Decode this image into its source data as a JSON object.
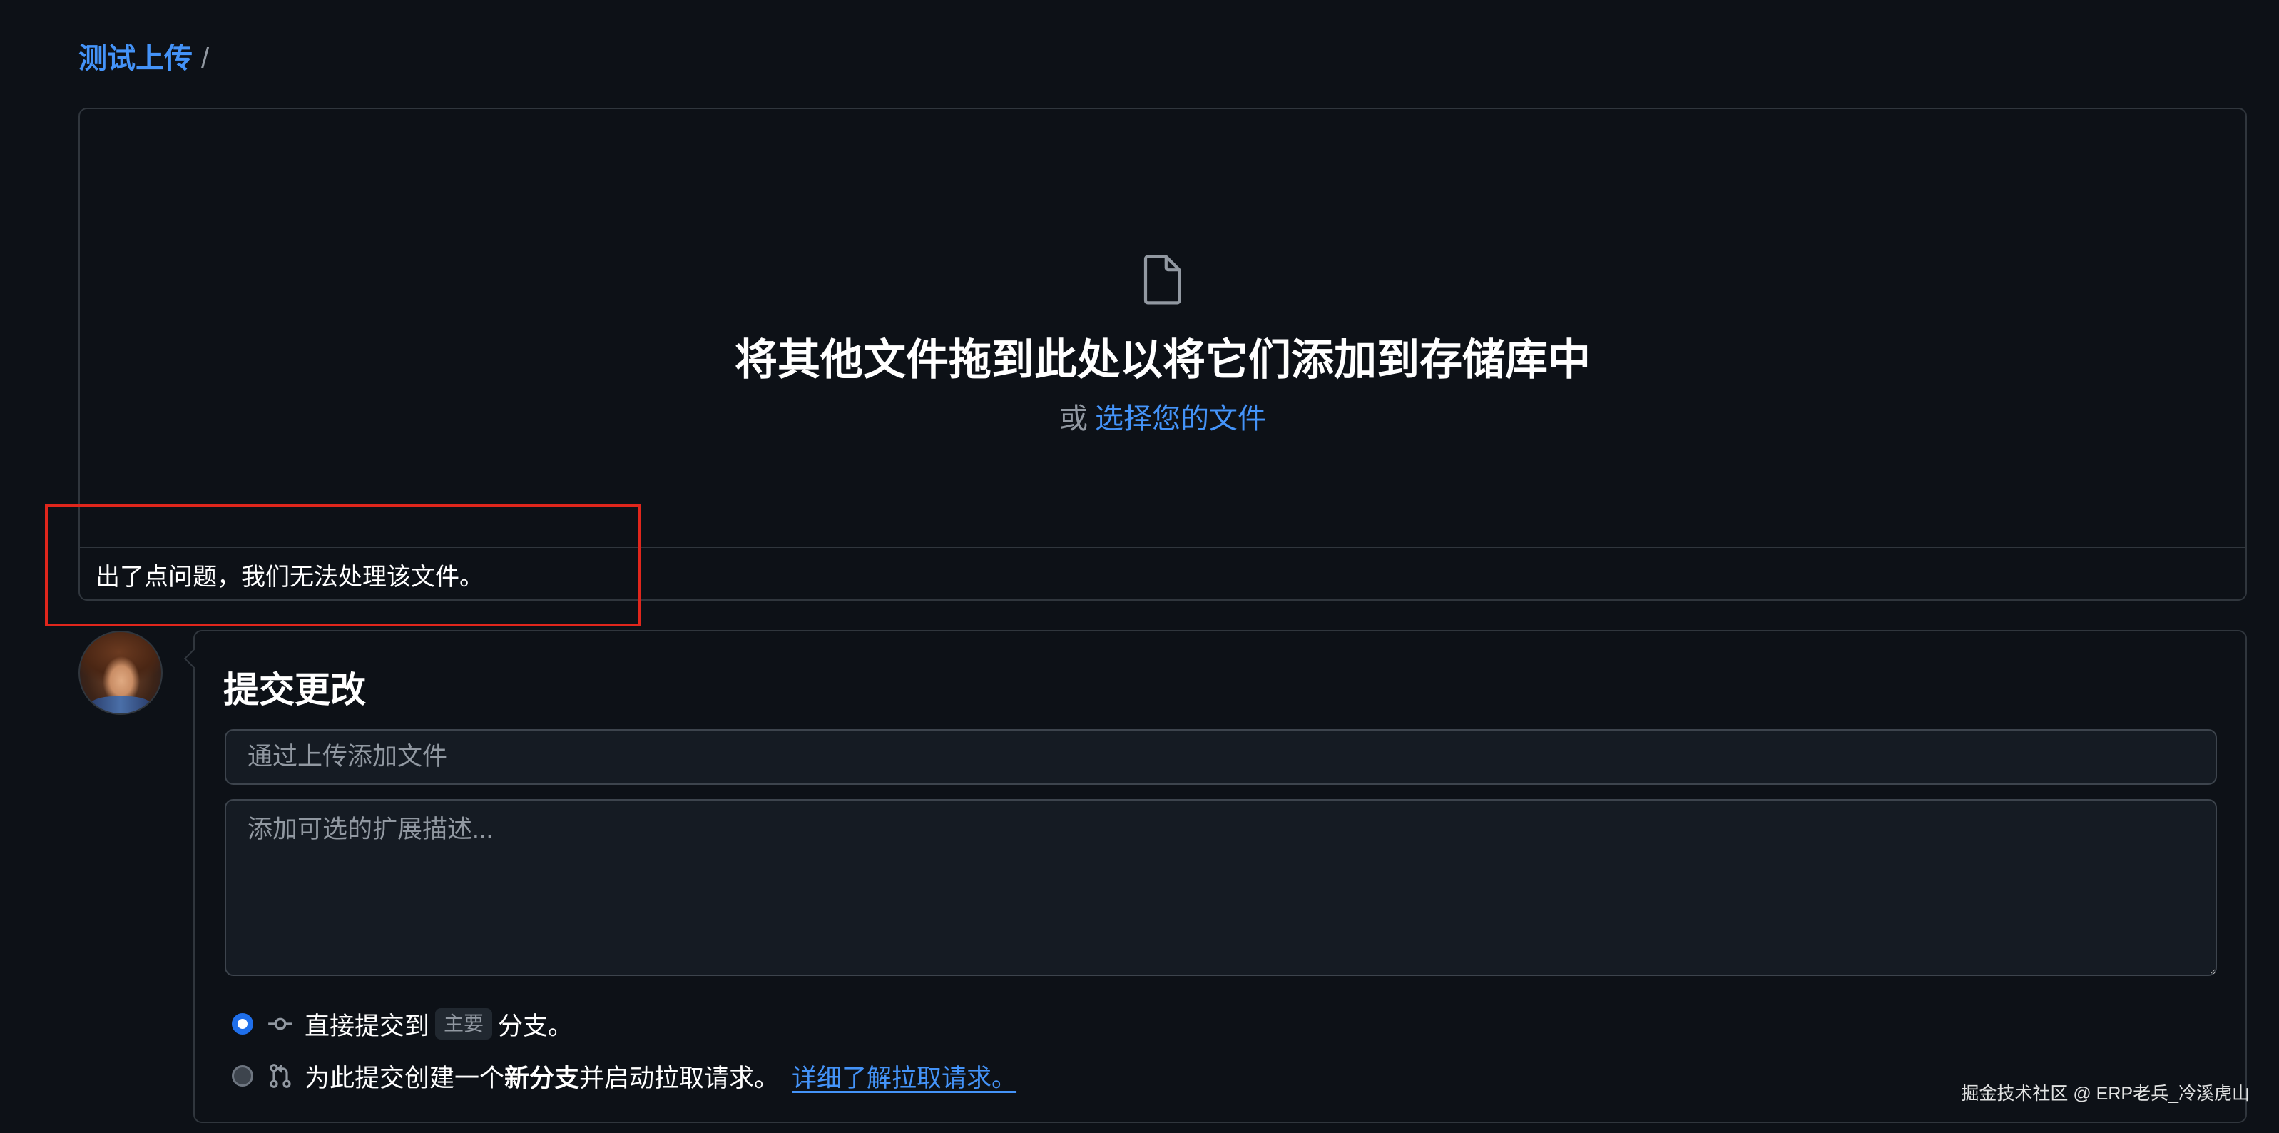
{
  "breadcrumb": {
    "repo_name": "测试上传",
    "separator": "/"
  },
  "dropzone": {
    "icon": "file-icon",
    "heading": "将其他文件拖到此处以将它们添加到存储库中",
    "or_text": "或",
    "choose_files_link": "选择您的文件",
    "error_message": "出了点问题，我们无法处理该文件。"
  },
  "commit": {
    "title": "提交更改",
    "summary_placeholder": "通过上传添加文件",
    "description_placeholder": "添加可选的扩展描述...",
    "direct": {
      "checked": true,
      "icon": "git-commit-icon",
      "prefix": "直接提交到",
      "branch": "主要",
      "suffix": "分支。"
    },
    "new_branch": {
      "checked": false,
      "icon": "git-pull-request-icon",
      "prefix": "为此提交创建一个",
      "bold": "新分支",
      "suffix": "并启动拉取请求。",
      "learn_more_link": "详细了解拉取请求。"
    }
  },
  "watermark": "掘金技术社区 @ ERP老兵_冷溪虎山",
  "colors": {
    "background": "#0d1117",
    "border": "#30363d",
    "text": "#e6edf3",
    "muted": "#9198a1",
    "link": "#4493f8",
    "accent": "#1f6feb",
    "highlight": "#e0261c"
  }
}
